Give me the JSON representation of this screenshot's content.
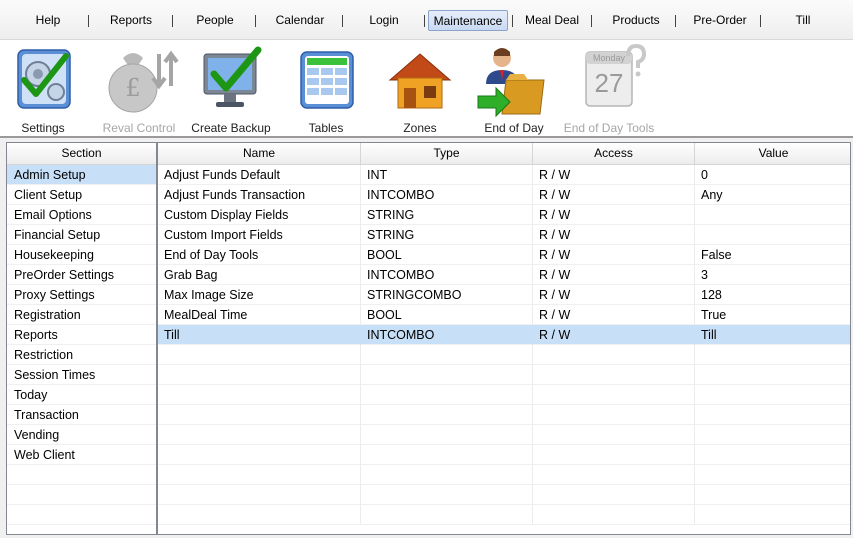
{
  "menu": {
    "items": [
      {
        "label": "Help"
      },
      {
        "label": "Reports"
      },
      {
        "label": "People"
      },
      {
        "label": "Calendar"
      },
      {
        "label": "Login"
      },
      {
        "label": "Maintenance",
        "active": true
      },
      {
        "label": "Meal Deal"
      },
      {
        "label": "Products"
      },
      {
        "label": "Pre-Order"
      },
      {
        "label": "Till"
      }
    ]
  },
  "toolbar": {
    "settings_label": "Settings",
    "reval_label": "Reval Control",
    "backup_label": "Create Backup",
    "tables_label": "Tables",
    "zones_label": "Zones",
    "endofday_label": "End of Day",
    "eodtools_label": "End of Day Tools",
    "calendar_day": "Monday",
    "calendar_date": "27"
  },
  "sections": {
    "header": "Section",
    "items": [
      {
        "label": "Admin Setup",
        "selected": true
      },
      {
        "label": "Client Setup"
      },
      {
        "label": "Email Options"
      },
      {
        "label": "Financial Setup"
      },
      {
        "label": "Housekeeping"
      },
      {
        "label": "PreOrder Settings"
      },
      {
        "label": "Proxy Settings"
      },
      {
        "label": "Registration"
      },
      {
        "label": "Reports"
      },
      {
        "label": "Restriction"
      },
      {
        "label": "Session Times"
      },
      {
        "label": "Today"
      },
      {
        "label": "Transaction"
      },
      {
        "label": "Vending"
      },
      {
        "label": "Web Client"
      }
    ]
  },
  "grid": {
    "columns": [
      "Name",
      "Type",
      "Access",
      "Value"
    ],
    "rows": [
      {
        "name": "Adjust Funds Default",
        "type": "INT",
        "access": "R / W",
        "value": "0"
      },
      {
        "name": "Adjust Funds Transaction",
        "type": "INTCOMBO",
        "access": "R / W",
        "value": "Any"
      },
      {
        "name": "Custom Display Fields",
        "type": "STRING",
        "access": "R / W",
        "value": ""
      },
      {
        "name": "Custom Import Fields",
        "type": "STRING",
        "access": "R / W",
        "value": ""
      },
      {
        "name": "End of Day Tools",
        "type": "BOOL",
        "access": "R / W",
        "value": "False"
      },
      {
        "name": "Grab Bag",
        "type": "INTCOMBO",
        "access": "R / W",
        "value": "3"
      },
      {
        "name": "Max Image Size",
        "type": "STRINGCOMBO",
        "access": "R / W",
        "value": "128"
      },
      {
        "name": "MealDeal Time",
        "type": "BOOL",
        "access": "R / W",
        "value": "True"
      },
      {
        "name": "Till",
        "type": "INTCOMBO",
        "access": "R / W",
        "value": "Till",
        "selected": true
      }
    ]
  },
  "colors": {
    "selection": "#c8dff8",
    "check_green": "#22a018",
    "house_orange": "#e8870c"
  }
}
